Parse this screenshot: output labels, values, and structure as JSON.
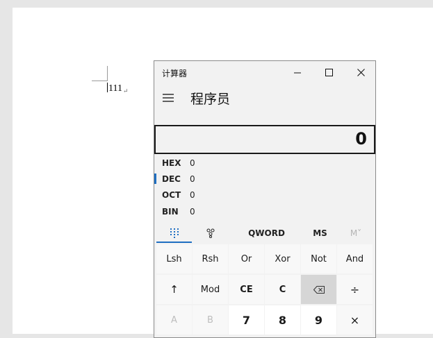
{
  "document": {
    "text": "111",
    "paragraph_mark": "↵"
  },
  "calculator": {
    "app_title": "计算器",
    "mode_title": "程序员",
    "display_value": "0",
    "radix": [
      {
        "label": "HEX",
        "value": "0",
        "active": false
      },
      {
        "label": "DEC",
        "value": "0",
        "active": true
      },
      {
        "label": "OCT",
        "value": "0",
        "active": false
      },
      {
        "label": "BIN",
        "value": "0",
        "active": false
      }
    ],
    "tabs": {
      "word_size": "QWORD",
      "memory_store": "MS",
      "memory_recall": "M˅"
    },
    "keys": {
      "row1": [
        "Lsh",
        "Rsh",
        "Or",
        "Xor",
        "Not",
        "And"
      ],
      "row2": [
        "↑",
        "Mod",
        "CE",
        "C",
        "⌫",
        "÷"
      ],
      "row3": [
        "A",
        "B",
        "7",
        "8",
        "9",
        "×"
      ]
    },
    "colors": {
      "accent": "#1f6fc2",
      "window_bg": "#f2f2f2",
      "pressed_key": "#d6d6d6"
    }
  }
}
